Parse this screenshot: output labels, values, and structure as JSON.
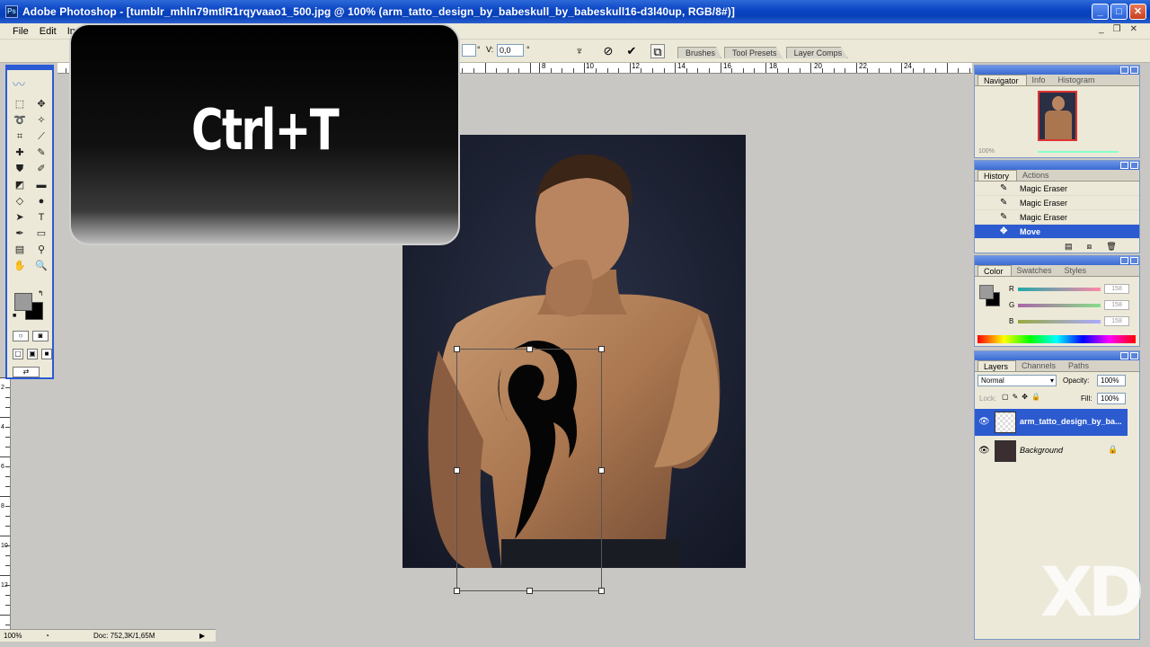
{
  "app": {
    "title": "Adobe Photoshop - [tumblr_mhln79mtlR1rqyvaao1_500.jpg @ 100% (arm_tatto_design_by_babeskull_by_babeskull16-d3l40up, RGB/8#)]",
    "icon": "photoshop-app-icon"
  },
  "window_buttons": {
    "minimize": "_",
    "maximize": "□",
    "close": "✕"
  },
  "menu": {
    "items": [
      "File",
      "Edit",
      "Im"
    ]
  },
  "doc_controls": {
    "minimize": "_",
    "restore": "❐",
    "close": "✕"
  },
  "options_bar": {
    "field_h_value": "",
    "v_label": "V:",
    "v_value": "0,0",
    "degree_unit": "°",
    "icons": [
      "warp-icon",
      "cancel-transform-icon",
      "commit-transform-icon",
      "palette-icon"
    ]
  },
  "palette_well": {
    "tabs": [
      "Brushes",
      "Tool Presets",
      "Layer Comps"
    ]
  },
  "ruler": {
    "top_labels": [
      "8",
      "10",
      "12",
      "14",
      "16",
      "18",
      "20",
      "22",
      "24"
    ],
    "left_labels": [
      "2",
      "4",
      "6",
      "8",
      "10",
      "12"
    ]
  },
  "shortcut_overlay": {
    "text": "Ctrl+T"
  },
  "navigator_panel": {
    "tabs": [
      "Navigator",
      "Info",
      "Histogram"
    ],
    "zoom": "100%"
  },
  "history_panel": {
    "tabs": [
      "History",
      "Actions"
    ],
    "rows": [
      {
        "label": "Magic Eraser",
        "icon": "magic-eraser-icon",
        "selected": false
      },
      {
        "label": "Magic Eraser",
        "icon": "magic-eraser-icon",
        "selected": false
      },
      {
        "label": "Magic Eraser",
        "icon": "magic-eraser-icon",
        "selected": false
      },
      {
        "label": "Move",
        "icon": "move-tool-icon",
        "selected": true
      }
    ]
  },
  "color_panel": {
    "tabs": [
      "Color",
      "Swatches",
      "Styles"
    ],
    "channels": [
      {
        "label": "R",
        "value": "158"
      },
      {
        "label": "G",
        "value": "158"
      },
      {
        "label": "B",
        "value": "158"
      }
    ],
    "foreground": "#9b9b9b",
    "background": "#000000"
  },
  "layers_panel": {
    "tabs": [
      "Layers",
      "Channels",
      "Paths"
    ],
    "blend_mode": "Normal",
    "opacity_label": "Opacity:",
    "opacity_value": "100%",
    "lock_label": "Lock:",
    "fill_label": "Fill:",
    "fill_value": "100%",
    "layers": [
      {
        "name": "arm_tatto_design_by_ba...",
        "selected": true,
        "locked": false
      },
      {
        "name": "Background",
        "selected": false,
        "locked": true
      }
    ]
  },
  "status_bar": {
    "zoom": "100%",
    "doc": "Doc: 752,3K/1,65M"
  },
  "watermark": {
    "text": "XD"
  },
  "colors": {
    "title_blue": "#0a43c2",
    "selection_blue": "#2c5bd0",
    "panel_bg": "#ece9d8",
    "workspace": "#c9c7c3"
  }
}
